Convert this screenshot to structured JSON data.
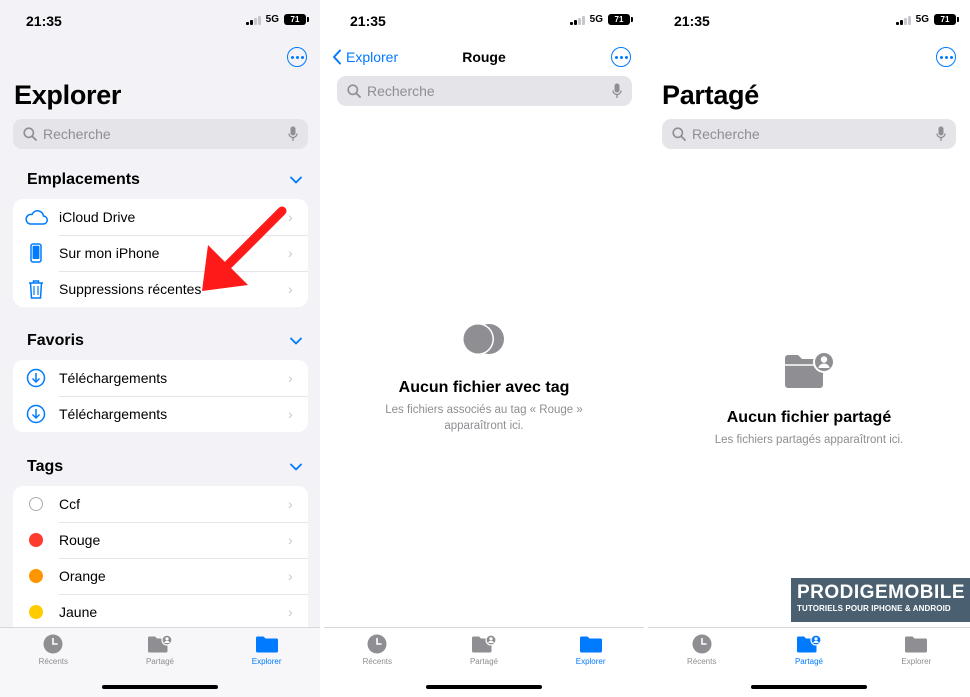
{
  "status": {
    "time": "21:35",
    "network": "5G",
    "battery": "71"
  },
  "screen1": {
    "title": "Explorer",
    "search_placeholder": "Recherche",
    "sections": {
      "locations": {
        "label": "Emplacements",
        "items": [
          {
            "label": "iCloud Drive",
            "icon": "cloud-icon"
          },
          {
            "label": "Sur mon iPhone",
            "icon": "iphone-icon"
          },
          {
            "label": "Suppressions récentes",
            "icon": "trash-icon"
          }
        ]
      },
      "favorites": {
        "label": "Favoris",
        "items": [
          {
            "label": "Téléchargements",
            "icon": "download-icon"
          },
          {
            "label": "Téléchargements",
            "icon": "download-icon"
          }
        ]
      },
      "tags": {
        "label": "Tags",
        "items": [
          {
            "label": "Ccf",
            "color": "#ffffff"
          },
          {
            "label": "Rouge",
            "color": "#ff3b30"
          },
          {
            "label": "Orange",
            "color": "#ff9500"
          },
          {
            "label": "Jaune",
            "color": "#ffcc00"
          }
        ]
      }
    },
    "tabs": [
      {
        "label": "Récents",
        "active": false
      },
      {
        "label": "Partagé",
        "active": false
      },
      {
        "label": "Explorer",
        "active": true
      }
    ]
  },
  "screen2": {
    "back_label": "Explorer",
    "title": "Rouge",
    "search_placeholder": "Recherche",
    "empty_title": "Aucun fichier avec tag",
    "empty_line1": "Les fichiers associés au tag « Rouge »",
    "empty_line2": "apparaîtront ici.",
    "tabs": [
      {
        "label": "Récents",
        "active": false
      },
      {
        "label": "Partagé",
        "active": false
      },
      {
        "label": "Explorer",
        "active": true
      }
    ]
  },
  "screen3": {
    "title": "Partagé",
    "search_placeholder": "Recherche",
    "empty_title": "Aucun fichier partagé",
    "empty_sub": "Les fichiers partagés apparaîtront ici.",
    "tabs": [
      {
        "label": "Récents",
        "active": false
      },
      {
        "label": "Partagé",
        "active": true
      },
      {
        "label": "Explorer",
        "active": false
      }
    ]
  },
  "watermark": {
    "brand": "PRODIGEMOBILE",
    "tagline": "TUTORIELS POUR IPHONE & ANDROID"
  },
  "colors": {
    "accent": "#007aff",
    "annotation_arrow": "#ff1a1a",
    "inactive_gray": "#8e8e93"
  }
}
